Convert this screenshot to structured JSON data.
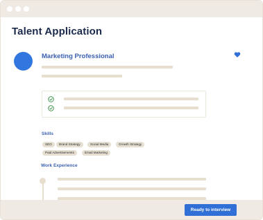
{
  "page": {
    "title": "Talent Application"
  },
  "profile": {
    "title": "Marketing Professional"
  },
  "sections": {
    "skills": {
      "label": "Skills",
      "items": [
        "SEO",
        "Brand Strategy",
        "Social Media",
        "Growth Strategy",
        "Paid Advertisements",
        "Email Marketing"
      ]
    },
    "experience": {
      "label": "Work Experience"
    }
  },
  "footer": {
    "cta_label": "Ready to interview"
  },
  "colors": {
    "accent": "#3277e0",
    "check": "#2e8b3a",
    "placeholder": "#e7dece",
    "frame": "#efebe4"
  },
  "icons": {
    "favorite": "heart-icon",
    "check": "check-circle-icon"
  }
}
